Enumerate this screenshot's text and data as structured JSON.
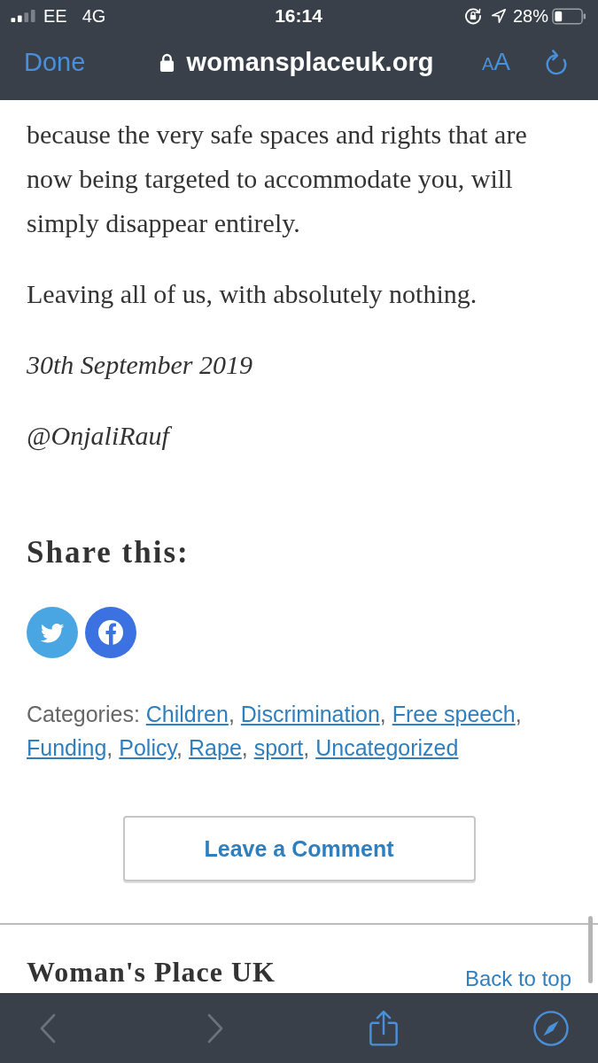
{
  "status_bar": {
    "carrier": "EE",
    "network": "4G",
    "time": "16:14",
    "battery": "28%"
  },
  "nav_bar": {
    "done": "Done",
    "secure": true,
    "url": "womansplaceuk.org",
    "text_size": "AA"
  },
  "article": {
    "paragraphs": [
      {
        "kind": "body",
        "text": "because the very safe spaces and rights that are now being targeted to accommodate you, will simply disappear entirely."
      },
      {
        "kind": "body",
        "text": "Leaving all of us, with absolutely nothing."
      },
      {
        "kind": "date",
        "text": "30th September 2019"
      },
      {
        "kind": "handle",
        "text": "@OnjaliRauf"
      }
    ]
  },
  "share": {
    "heading": "Share this:",
    "buttons": [
      {
        "kind": "twitter"
      },
      {
        "kind": "facebook"
      }
    ]
  },
  "categories": {
    "label": "Categories:",
    "separator": ",",
    "links": [
      "Children",
      "Discrimination",
      "Free speech",
      "Funding",
      "Policy",
      "Rape",
      "sport",
      "Uncategorized"
    ]
  },
  "comment_button": "Leave a Comment",
  "footer": {
    "title": "Woman's Place UK",
    "back_to_top": "Back to top"
  },
  "toolbar": {
    "buttons": [
      {
        "kind": "back",
        "disabled": true
      },
      {
        "kind": "forward",
        "disabled": true
      },
      {
        "kind": "share",
        "disabled": false
      },
      {
        "kind": "compass",
        "disabled": false
      }
    ]
  }
}
